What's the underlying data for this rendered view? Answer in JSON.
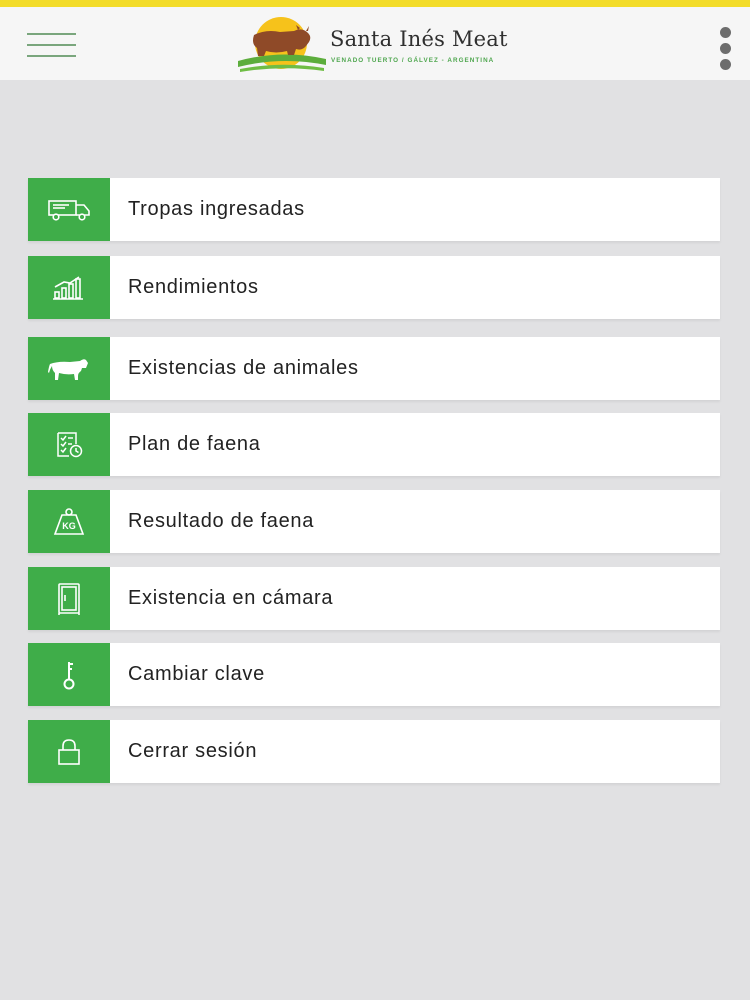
{
  "header": {
    "brand_name": "Santa Inés Meat",
    "brand_subtitle": "VENADO TUERTO / GÁLVEZ - ARGENTINA",
    "accent_color": "#f3dc2a"
  },
  "menu": {
    "accent_color": "#3fad49",
    "items": [
      {
        "label": "Tropas ingresadas",
        "icon": "truck-icon"
      },
      {
        "label": "Rendimientos",
        "icon": "bar-chart-icon"
      },
      {
        "label": "Existencias de animales",
        "icon": "cow-icon"
      },
      {
        "label": "Plan de faena",
        "icon": "checklist-clock-icon"
      },
      {
        "label": "Resultado de faena",
        "icon": "kg-weight-icon"
      },
      {
        "label": "Existencia en cámara",
        "icon": "refrigerator-icon"
      },
      {
        "label": "Cambiar clave",
        "icon": "key-icon"
      },
      {
        "label": "Cerrar sesión",
        "icon": "padlock-icon"
      }
    ]
  }
}
